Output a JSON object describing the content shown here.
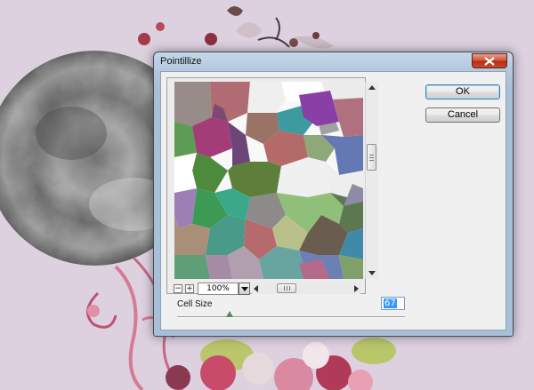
{
  "dialog": {
    "title": "Pointillize",
    "ok_label": "OK",
    "cancel_label": "Cancel",
    "close_icon": "close-icon",
    "accent_close": "#c9472b"
  },
  "preview": {
    "zoom_level": "100%",
    "zoom_out_label": "−",
    "zoom_in_label": "+"
  },
  "cell_size": {
    "label": "Cell Size",
    "value": "67"
  },
  "colors": {
    "canvas_background": "#ddd1e0",
    "dialog_frame": "#a9bfd8",
    "client_background": "#f0f0f0"
  }
}
